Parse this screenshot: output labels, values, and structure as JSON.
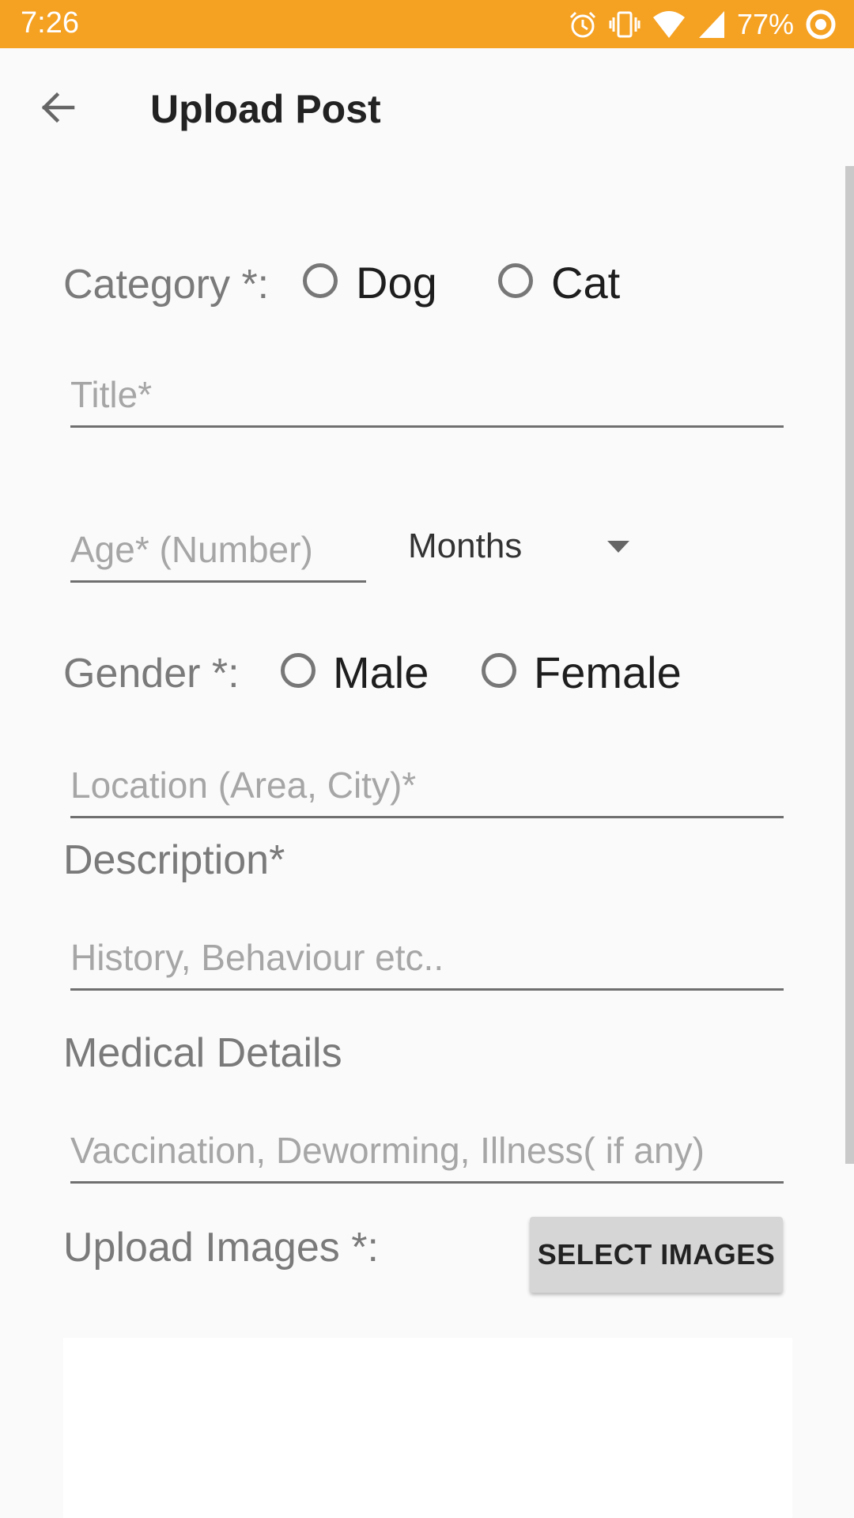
{
  "status_bar": {
    "time": "7:26",
    "battery_percent": "77%",
    "icons": [
      "alarm-icon",
      "vibrate-icon",
      "wifi-icon",
      "signal-icon",
      "battery-icon"
    ],
    "color": "#f5a122"
  },
  "app_bar": {
    "title": "Upload Post",
    "back_icon": "arrow-back-icon"
  },
  "form": {
    "category": {
      "label": "Category *:",
      "options": [
        "Dog",
        "Cat"
      ]
    },
    "title_field": {
      "placeholder": "Title*",
      "value": ""
    },
    "age_field": {
      "placeholder": "Age* (Number)",
      "value": ""
    },
    "age_unit_dropdown": {
      "selected": "Months"
    },
    "gender": {
      "label": "Gender *:",
      "options": [
        "Male",
        "Female"
      ]
    },
    "location_field": {
      "placeholder": "Location (Area, City)*",
      "value": ""
    },
    "description": {
      "label": "Description*",
      "placeholder": "History, Behaviour etc.."
    },
    "medical": {
      "label": "Medical Details",
      "placeholder": "Vaccination, Deworming, Illness( if any)"
    },
    "upload_images": {
      "label": "Upload Images *:",
      "button_label": "SELECT IMAGES"
    }
  }
}
